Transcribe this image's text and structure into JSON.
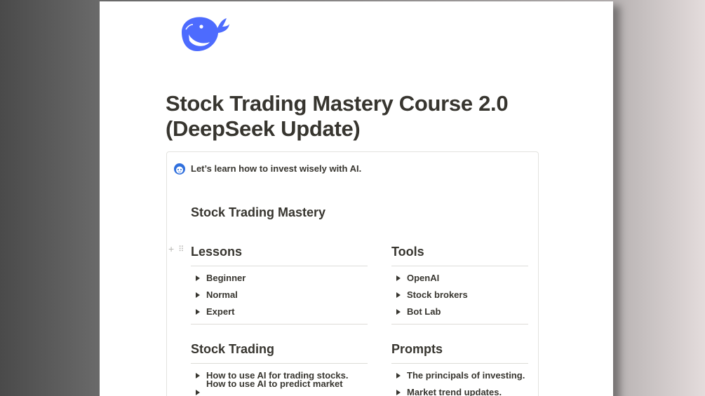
{
  "page": {
    "title": "Stock Trading Mastery Course 2.0 (DeepSeek Update)",
    "logo_icon": "deepseek-whale-icon",
    "brand_color": "#4d6bfe"
  },
  "callout": {
    "icon": "face-icon",
    "text": "Let’s learn how to invest wisely with AI.",
    "heading": "Stock Trading Mastery"
  },
  "block_handle": {
    "add_symbol": "+",
    "drag_symbol": "⠿"
  },
  "columns": {
    "lessons": {
      "title": "Lessons",
      "items": [
        "Beginner",
        "Normal",
        "Expert"
      ]
    },
    "tools": {
      "title": "Tools",
      "items": [
        "OpenAI",
        "Stock brokers",
        "Bot Lab"
      ]
    },
    "stock_trading": {
      "title": "Stock Trading",
      "items": [
        "How to use AI for trading stocks.",
        "How to use AI to predict market trends."
      ]
    },
    "prompts": {
      "title": "Prompts",
      "items": [
        "The principals of investing.",
        "Market trend updates."
      ]
    }
  }
}
